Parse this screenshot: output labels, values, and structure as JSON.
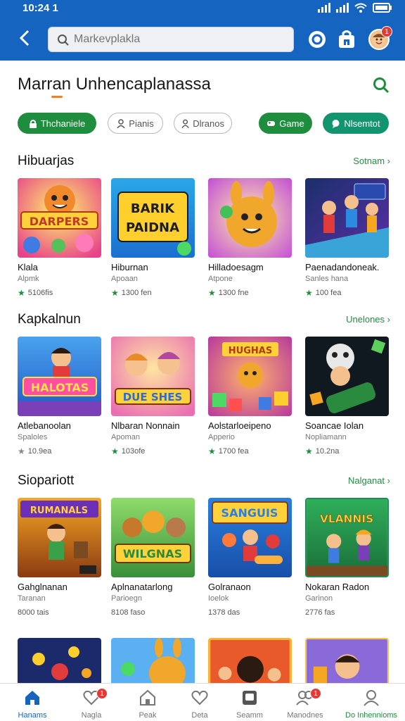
{
  "status": {
    "time": "10:24 1"
  },
  "search": {
    "placeholder": "Markevplakla",
    "value": ""
  },
  "header": {
    "title": "Marran Unhencaplanassa"
  },
  "avatar_badge": "1",
  "chips": [
    {
      "label": "Thchaniele",
      "icon": "lock-icon",
      "style": "green"
    },
    {
      "label": "Pianis",
      "icon": "person-icon",
      "style": "outline"
    },
    {
      "label": "Dlranos",
      "icon": "person-icon",
      "style": "outline"
    },
    {
      "label": "Game",
      "icon": "gamepad-icon",
      "style": "green"
    },
    {
      "label": "Nlsemtot",
      "icon": "chat-icon",
      "style": "teal"
    }
  ],
  "sections": [
    {
      "title": "Hibuarjas",
      "link": "Sotnam",
      "cards": [
        {
          "name": "Klala",
          "dev": "Alpmk",
          "rating": "5106fis",
          "art": "DARPERS"
        },
        {
          "name": "Hiburnan",
          "dev": "Apoaan",
          "rating": "1300 fen",
          "art": "BARIK PAIDNA"
        },
        {
          "name": "Hilladoesagm",
          "dev": "Atpone",
          "rating": "1300 fne",
          "art": ""
        },
        {
          "name": "Paenadandoneak.",
          "dev": "Sanles hana",
          "rating": "100 fea",
          "art": ""
        }
      ]
    },
    {
      "title": "Kapkalnun",
      "link": "Unelones",
      "cards": [
        {
          "name": "Atlebanoolan",
          "dev": "Spaloles",
          "rating": "10.9ea",
          "art": "HALOTAS"
        },
        {
          "name": "Nlbaran Nonnain",
          "dev": "Apoman",
          "rating": "103ofe",
          "art": "DUE SHES"
        },
        {
          "name": "Aolstarloeipeno",
          "dev": "Apperio",
          "rating": "1700 fea",
          "art": "HUGHAS"
        },
        {
          "name": "Soancae Iolan",
          "dev": "Nopliamann",
          "rating": "10.2na",
          "art": ""
        }
      ]
    },
    {
      "title": "Siopariott",
      "link": "Nalganat",
      "cards": [
        {
          "name": "Gahglnanan",
          "dev": "Taranan",
          "rating": "8000 tais",
          "art": "RUMANALS"
        },
        {
          "name": "Aplnanatarlong",
          "dev": "Parioegn",
          "rating": "8108 faso",
          "art": "WILGNAS"
        },
        {
          "name": "Golranaon",
          "dev": "Ioelok",
          "rating": "1378 das",
          "art": "SANGUIS"
        },
        {
          "name": "Nokaran Radon",
          "dev": "Garinon",
          "rating": "2776 fas",
          "art": "VLANNIS"
        }
      ]
    }
  ],
  "nav": [
    {
      "label": "Hanams",
      "icon": "home-icon",
      "active": true,
      "badge": ""
    },
    {
      "label": "Nagla",
      "icon": "heart-icon",
      "active": false,
      "badge": "1"
    },
    {
      "label": "Peak",
      "icon": "house-icon",
      "active": false,
      "badge": ""
    },
    {
      "label": "Deta",
      "icon": "heart-outline-icon",
      "active": false,
      "badge": ""
    },
    {
      "label": "Seamm",
      "icon": "tablet-icon",
      "active": false,
      "badge": ""
    },
    {
      "label": "Manodnes",
      "icon": "people-icon",
      "active": false,
      "badge": "1"
    },
    {
      "label": "Do Inhennioms",
      "icon": "account-icon",
      "active": false,
      "badge": ""
    }
  ],
  "colors": {
    "primary": "#1565c0",
    "accent": "#1e8e3e",
    "badge": "#e53935"
  }
}
